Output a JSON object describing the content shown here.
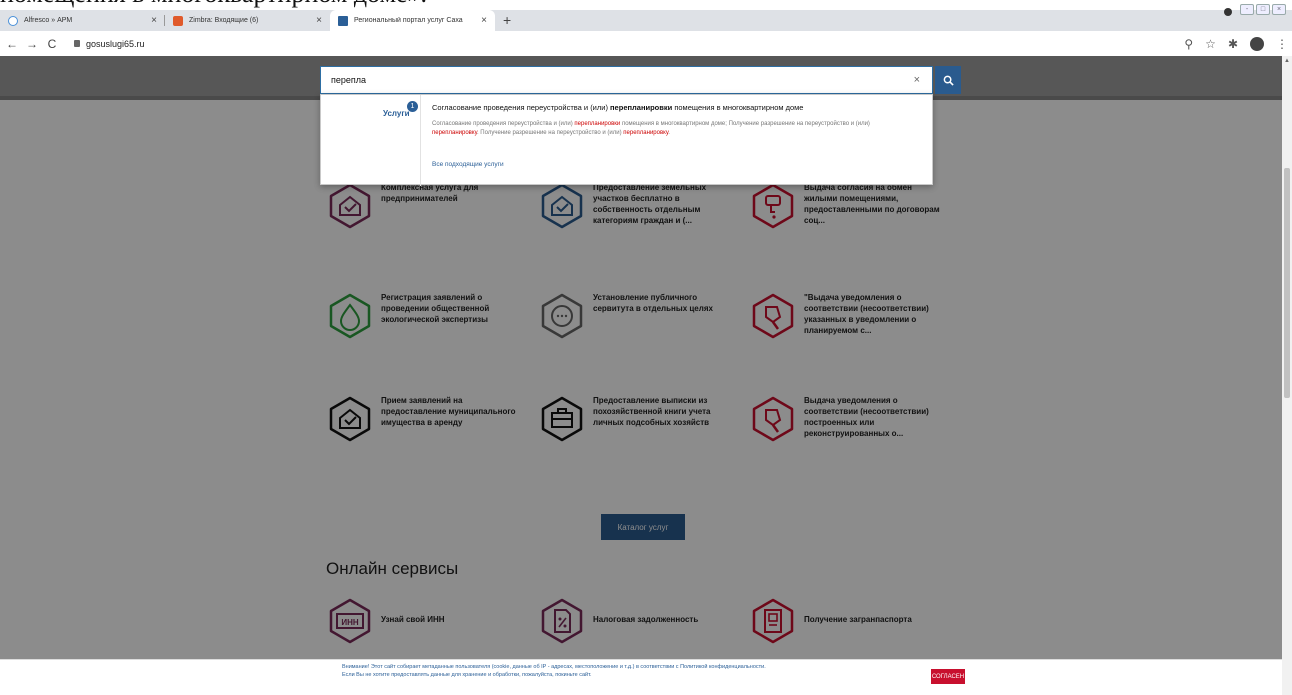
{
  "overflow_text": "помещения в многоквартирном доме».",
  "browser": {
    "tabs": [
      {
        "title": "Alfresco » АРМ",
        "icon_color": "#4a90d9"
      },
      {
        "title": "Zimbra: Входящие (6)",
        "icon_color": "#e05a2b"
      },
      {
        "title": "Региональный портал услуг Саха",
        "icon_color": "#2b5f97"
      }
    ],
    "new_tab": "+",
    "close": "×",
    "back": "←",
    "forward": "→",
    "reload": "C",
    "url": "gosuslugi65.ru"
  },
  "search": {
    "query": "перепла",
    "clear": "×"
  },
  "suggestions": {
    "category": "Услуги",
    "count": "1",
    "title_before": "Согласование проведения переустройства и (или) ",
    "title_bold": "перепланировки",
    "title_after": " помещения в многоквартирном доме",
    "desc_1": "Согласование проведения переустройства и (или) ",
    "desc_hl1": "перепланировки",
    "desc_2": " помещения в многоквартирном доме; Получение разрешение на переустройство и (или) ",
    "desc_hl2": "перепланировку",
    "desc_3": ". Получение разрешение на переустройство и (или) ",
    "desc_hl3": "перепланировку",
    "desc_4": ".",
    "all_link": "Все подходящие услуги"
  },
  "services": [
    {
      "label": "Комплексная услуга для предпринимателей",
      "icon": "house-check-icon",
      "color": "#7a2a5a"
    },
    {
      "label": "Предоставление земельных участков бесплатно в собственность отдельным категориям граждан и (...",
      "icon": "house-check-icon",
      "color": "#2a5b8e"
    },
    {
      "label": "Выдача согласия на обмен жилыми помещениями, предоставленными по договорам соц...",
      "icon": "faucet-icon",
      "color": "#c8102e"
    },
    {
      "label": "Регистрация заявлений о проведении общественной экологической экспертизы",
      "icon": "water-drop-icon",
      "color": "#2e9e3e"
    },
    {
      "label": "Установление публичного сервитута в отдельных целях",
      "icon": "chat-bubble-icon",
      "color": "#666666"
    },
    {
      "label": "\"Выдача уведомления о соответствии (несоответствии) указанных в уведомлении о планируемом с...",
      "icon": "trowel-icon",
      "color": "#c8102e"
    },
    {
      "label": "Прием заявлений на предоставление муниципального имущества в аренду",
      "icon": "house-check-icon",
      "color": "#111111"
    },
    {
      "label": "Предоставление выписки из похозяйственной книги учета личных подсобных хозяйств",
      "icon": "briefcase-icon",
      "color": "#111111"
    },
    {
      "label": "Выдача уведомления о соответствии (несоответствии) построенных или реконструированных о...",
      "icon": "trowel-icon",
      "color": "#c8102e"
    }
  ],
  "catalog_button": "Каталог услуг",
  "online_section": {
    "title": "Онлайн сервисы",
    "items": [
      {
        "label": "Узнай свой ИНН",
        "icon": "inn-icon",
        "icon_text": "ИНН",
        "color": "#7a2a5a"
      },
      {
        "label": "Налоговая задолженность",
        "icon": "tax-percent-icon",
        "color": "#7a2a5a"
      },
      {
        "label": "Получение загранпаспорта",
        "icon": "passport-icon",
        "color": "#c8102e"
      }
    ]
  },
  "cookie": {
    "line1": "Внимание! Этот сайт собирает метаданные пользователя (cookie, данные об IP - адресах, местоположение и т.д.) в соответствии с Политикой конфиденциальности.",
    "line2": "Если Вы не хотите предоставлять данные для хранение и обработки, пожалуйста, покиньте сайт.",
    "button": "СОГЛАСЕН"
  }
}
